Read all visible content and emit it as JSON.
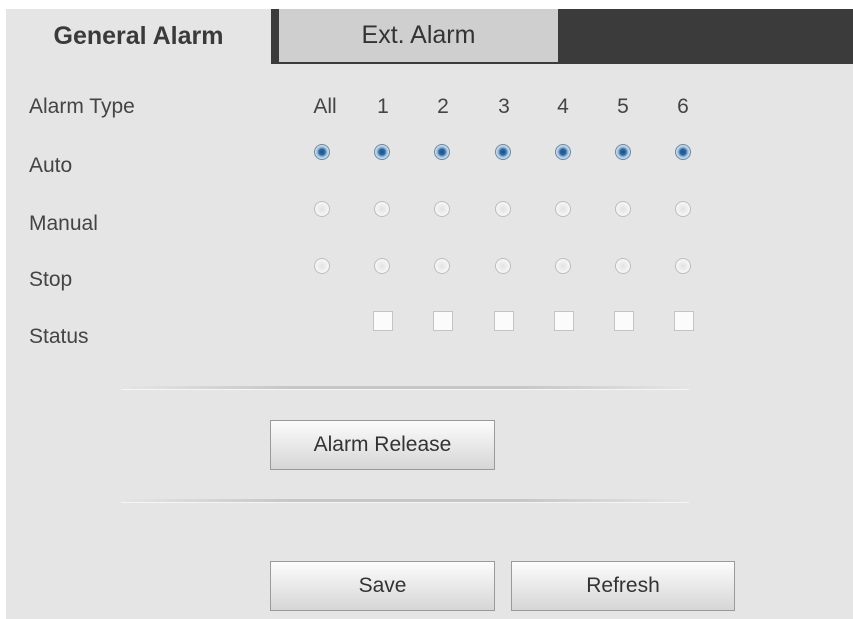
{
  "tabs": {
    "general": "General Alarm",
    "ext": "Ext. Alarm"
  },
  "rows": {
    "alarm_type": "Alarm Type",
    "auto": "Auto",
    "manual": "Manual",
    "stop": "Stop",
    "status": "Status"
  },
  "columns": [
    "All",
    "1",
    "2",
    "3",
    "4",
    "5",
    "6"
  ],
  "selected_mode": "Auto",
  "buttons": {
    "alarm_release": "Alarm Release",
    "save": "Save",
    "refresh": "Refresh"
  },
  "colors": {
    "panel_bg": "#e5e5e5",
    "tabbar_bg": "#3b3b3b",
    "inactive_tab_bg": "#cfcfcf",
    "radio_selected": "#2f6aa4"
  }
}
